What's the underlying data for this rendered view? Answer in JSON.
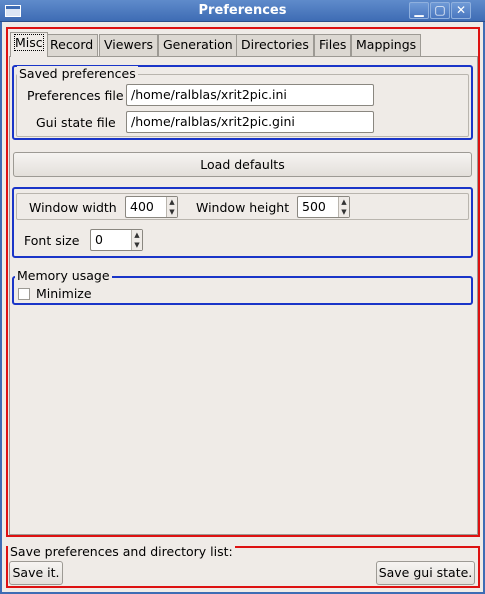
{
  "window": {
    "title": "Preferences",
    "controls": {
      "minimize": "▁",
      "maximize": "▢",
      "close": "✕"
    }
  },
  "tabs": [
    {
      "label": "Misc"
    },
    {
      "label": "Record"
    },
    {
      "label": "Viewers"
    },
    {
      "label": "Generation"
    },
    {
      "label": "Directories"
    },
    {
      "label": "Files"
    },
    {
      "label": "Mappings"
    }
  ],
  "saved_preferences": {
    "legend": "Saved preferences",
    "preferences_file_label": "Preferences file",
    "preferences_file_value": "/home/ralblas/xrit2pic.ini",
    "gui_state_file_label": "Gui state file",
    "gui_state_file_value": "/home/ralblas/xrit2pic.gini"
  },
  "load_defaults_label": "Load defaults",
  "window_settings": {
    "width_label": "Window width",
    "width_value": "400",
    "height_label": "Window height",
    "height_value": "500",
    "font_size_label": "Font size",
    "font_size_value": "0"
  },
  "memory_usage": {
    "legend": "Memory usage",
    "minimize_label": "Minimize",
    "minimize_checked": false
  },
  "save_section": {
    "legend": "Save preferences and directory list:",
    "save_it_label": "Save it.",
    "save_gui_state_label": "Save gui state."
  },
  "colors": {
    "titlebar": "#3e6cb4",
    "highlight_red": "#dd1111",
    "highlight_blue": "#1a35c8"
  }
}
